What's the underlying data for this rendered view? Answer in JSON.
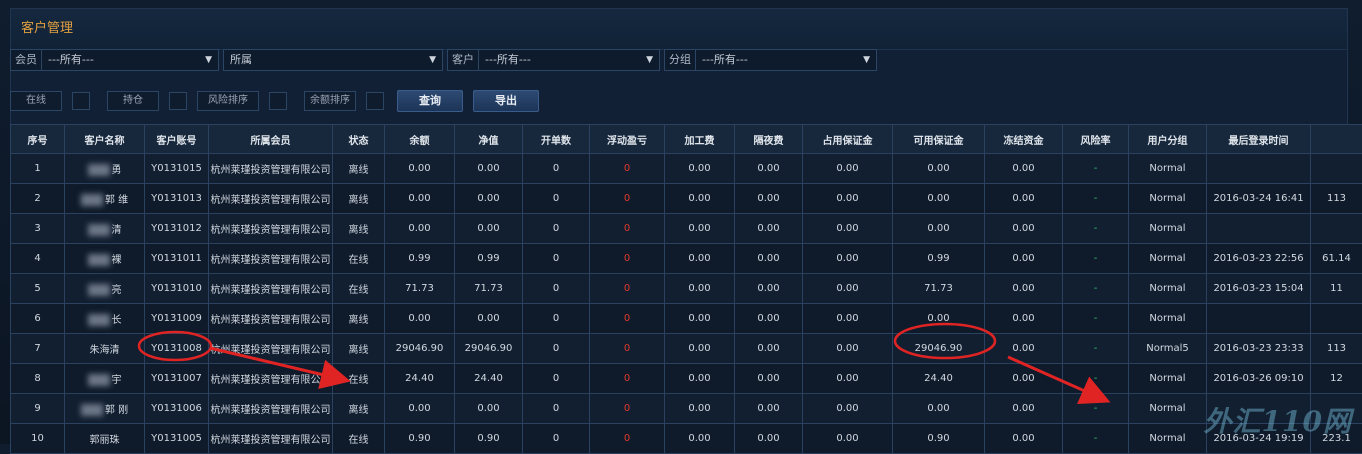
{
  "panel": {
    "title": "客户管理"
  },
  "filters": [
    {
      "label": "会员",
      "value": "---所有---"
    },
    {
      "label": "",
      "value": "所属"
    },
    {
      "label": "客户",
      "value": "---所有---"
    },
    {
      "label": "分组",
      "value": "---所有---"
    }
  ],
  "chips": [
    "在线",
    "持仓",
    "风险排序",
    "余额排序"
  ],
  "buttons": {
    "query": "查询",
    "export": "导出"
  },
  "table": {
    "headers": [
      "序号",
      "客户名称",
      "客户账号",
      "所属会员",
      "状态",
      "余额",
      "净值",
      "开单数",
      "浮动盈亏",
      "加工费",
      "隔夜费",
      "占用保证金",
      "可用保证金",
      "冻结资金",
      "风险率",
      "用户分组",
      "最后登录时间",
      ""
    ],
    "rows": [
      [
        "1",
        "勇",
        "Y0131015",
        "杭州莱瑾投资管理有限公司",
        "离线",
        "0.00",
        "0.00",
        "0",
        "0",
        "0.00",
        "0.00",
        "0.00",
        "0.00",
        "0.00",
        "-",
        "Normal",
        "",
        ""
      ],
      [
        "2",
        "郭 维",
        "Y0131013",
        "杭州莱瑾投资管理有限公司",
        "离线",
        "0.00",
        "0.00",
        "0",
        "0",
        "0.00",
        "0.00",
        "0.00",
        "0.00",
        "0.00",
        "-",
        "Normal",
        "2016-03-24 16:41",
        "113"
      ],
      [
        "3",
        "清",
        "Y0131012",
        "杭州莱瑾投资管理有限公司",
        "离线",
        "0.00",
        "0.00",
        "0",
        "0",
        "0.00",
        "0.00",
        "0.00",
        "0.00",
        "0.00",
        "-",
        "Normal",
        "",
        ""
      ],
      [
        "4",
        "裸",
        "Y0131011",
        "杭州莱瑾投资管理有限公司",
        "在线",
        "0.99",
        "0.99",
        "0",
        "0",
        "0.00",
        "0.00",
        "0.00",
        "0.99",
        "0.00",
        "-",
        "Normal",
        "2016-03-23 22:56",
        "61.14"
      ],
      [
        "5",
        "亮",
        "Y0131010",
        "杭州莱瑾投资管理有限公司",
        "在线",
        "71.73",
        "71.73",
        "0",
        "0",
        "0.00",
        "0.00",
        "0.00",
        "71.73",
        "0.00",
        "-",
        "Normal",
        "2016-03-23 15:04",
        "11"
      ],
      [
        "6",
        "长",
        "Y0131009",
        "杭州莱瑾投资管理有限公司",
        "离线",
        "0.00",
        "0.00",
        "0",
        "0",
        "0.00",
        "0.00",
        "0.00",
        "0.00",
        "0.00",
        "-",
        "Normal",
        "",
        ""
      ],
      [
        "7",
        "朱海清",
        "Y0131008",
        "杭州莱瑾投资管理有限公司",
        "离线",
        "29046.90",
        "29046.90",
        "0",
        "0",
        "0.00",
        "0.00",
        "0.00",
        "29046.90",
        "0.00",
        "-",
        "Normal5",
        "2016-03-23 23:33",
        "113"
      ],
      [
        "8",
        "宇",
        "Y0131007",
        "杭州莱瑾投资管理有限公司",
        "在线",
        "24.40",
        "24.40",
        "0",
        "0",
        "0.00",
        "0.00",
        "0.00",
        "24.40",
        "0.00",
        "-",
        "Normal",
        "2016-03-26 09:10",
        "12"
      ],
      [
        "9",
        "郭 刚",
        "Y0131006",
        "杭州莱瑾投资管理有限公司",
        "离线",
        "0.00",
        "0.00",
        "0",
        "0",
        "0.00",
        "0.00",
        "0.00",
        "0.00",
        "0.00",
        "-",
        "Normal",
        "",
        ""
      ],
      [
        "10",
        "郭丽珠",
        "Y0131005",
        "杭州莱瑾投资管理有限公司",
        "在线",
        "0.90",
        "0.90",
        "0",
        "0",
        "0.00",
        "0.00",
        "0.00",
        "0.90",
        "0.00",
        "-",
        "Normal",
        "2016-03-24 19:19",
        "223.1"
      ]
    ]
  },
  "watermark": "外汇110网",
  "colors": {
    "accent_title": "#e0a040",
    "loss_red": "#e23a2a",
    "risk_green": "#2ec46e",
    "annotation_red": "#e02424"
  }
}
